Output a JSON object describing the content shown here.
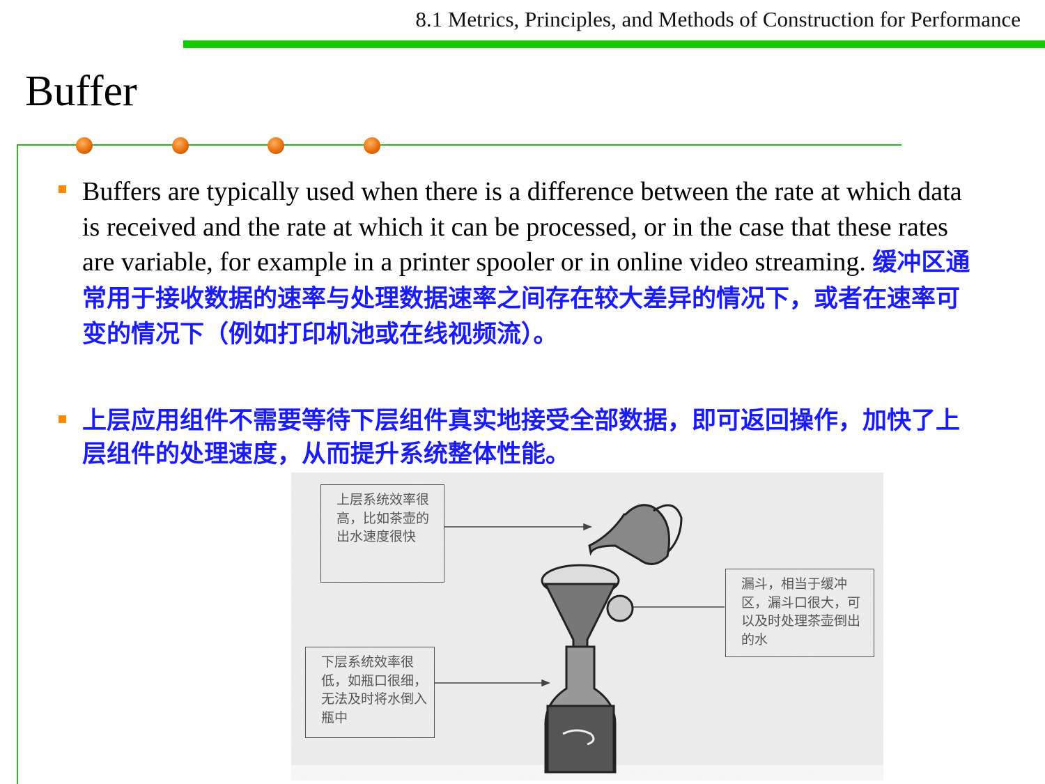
{
  "header": {
    "section_title": "8.1 Metrics, Principles, and Methods of Construction for Performance"
  },
  "slide": {
    "title": "Buffer",
    "bullets": [
      {
        "en": "Buffers are typically used when there is a difference between the rate at which data is received and the rate at which it can be processed, or in the case that these rates are variable, for example in a printer spooler or in online video streaming.",
        "zh": "缓冲区通常用于接收数据的速率与处理数据速率之间存在较大差异的情况下，或者在速率可变的情况下（例如打印机池或在线视频流）。"
      },
      {
        "en": "",
        "zh": "上层应用组件不需要等待下层组件真实地接受全部数据，即可返回操作，加快了上层组件的处理速度，从而提升系统整体性能。"
      }
    ]
  },
  "figure": {
    "upper_box": "上层系统效率很高，比如茶壶的出水速度很快",
    "funnel_box": "漏斗，相当于缓冲区，漏斗口很大，可以及时处理茶壶倒出的水",
    "lower_box": "下层系统效率很低，如瓶口很细，无法及时将水倒入瓶中"
  },
  "colors": {
    "accent_green": "#11cc00",
    "bullet_orange": "#ff8800",
    "chinese_text": "#1a1aff"
  }
}
